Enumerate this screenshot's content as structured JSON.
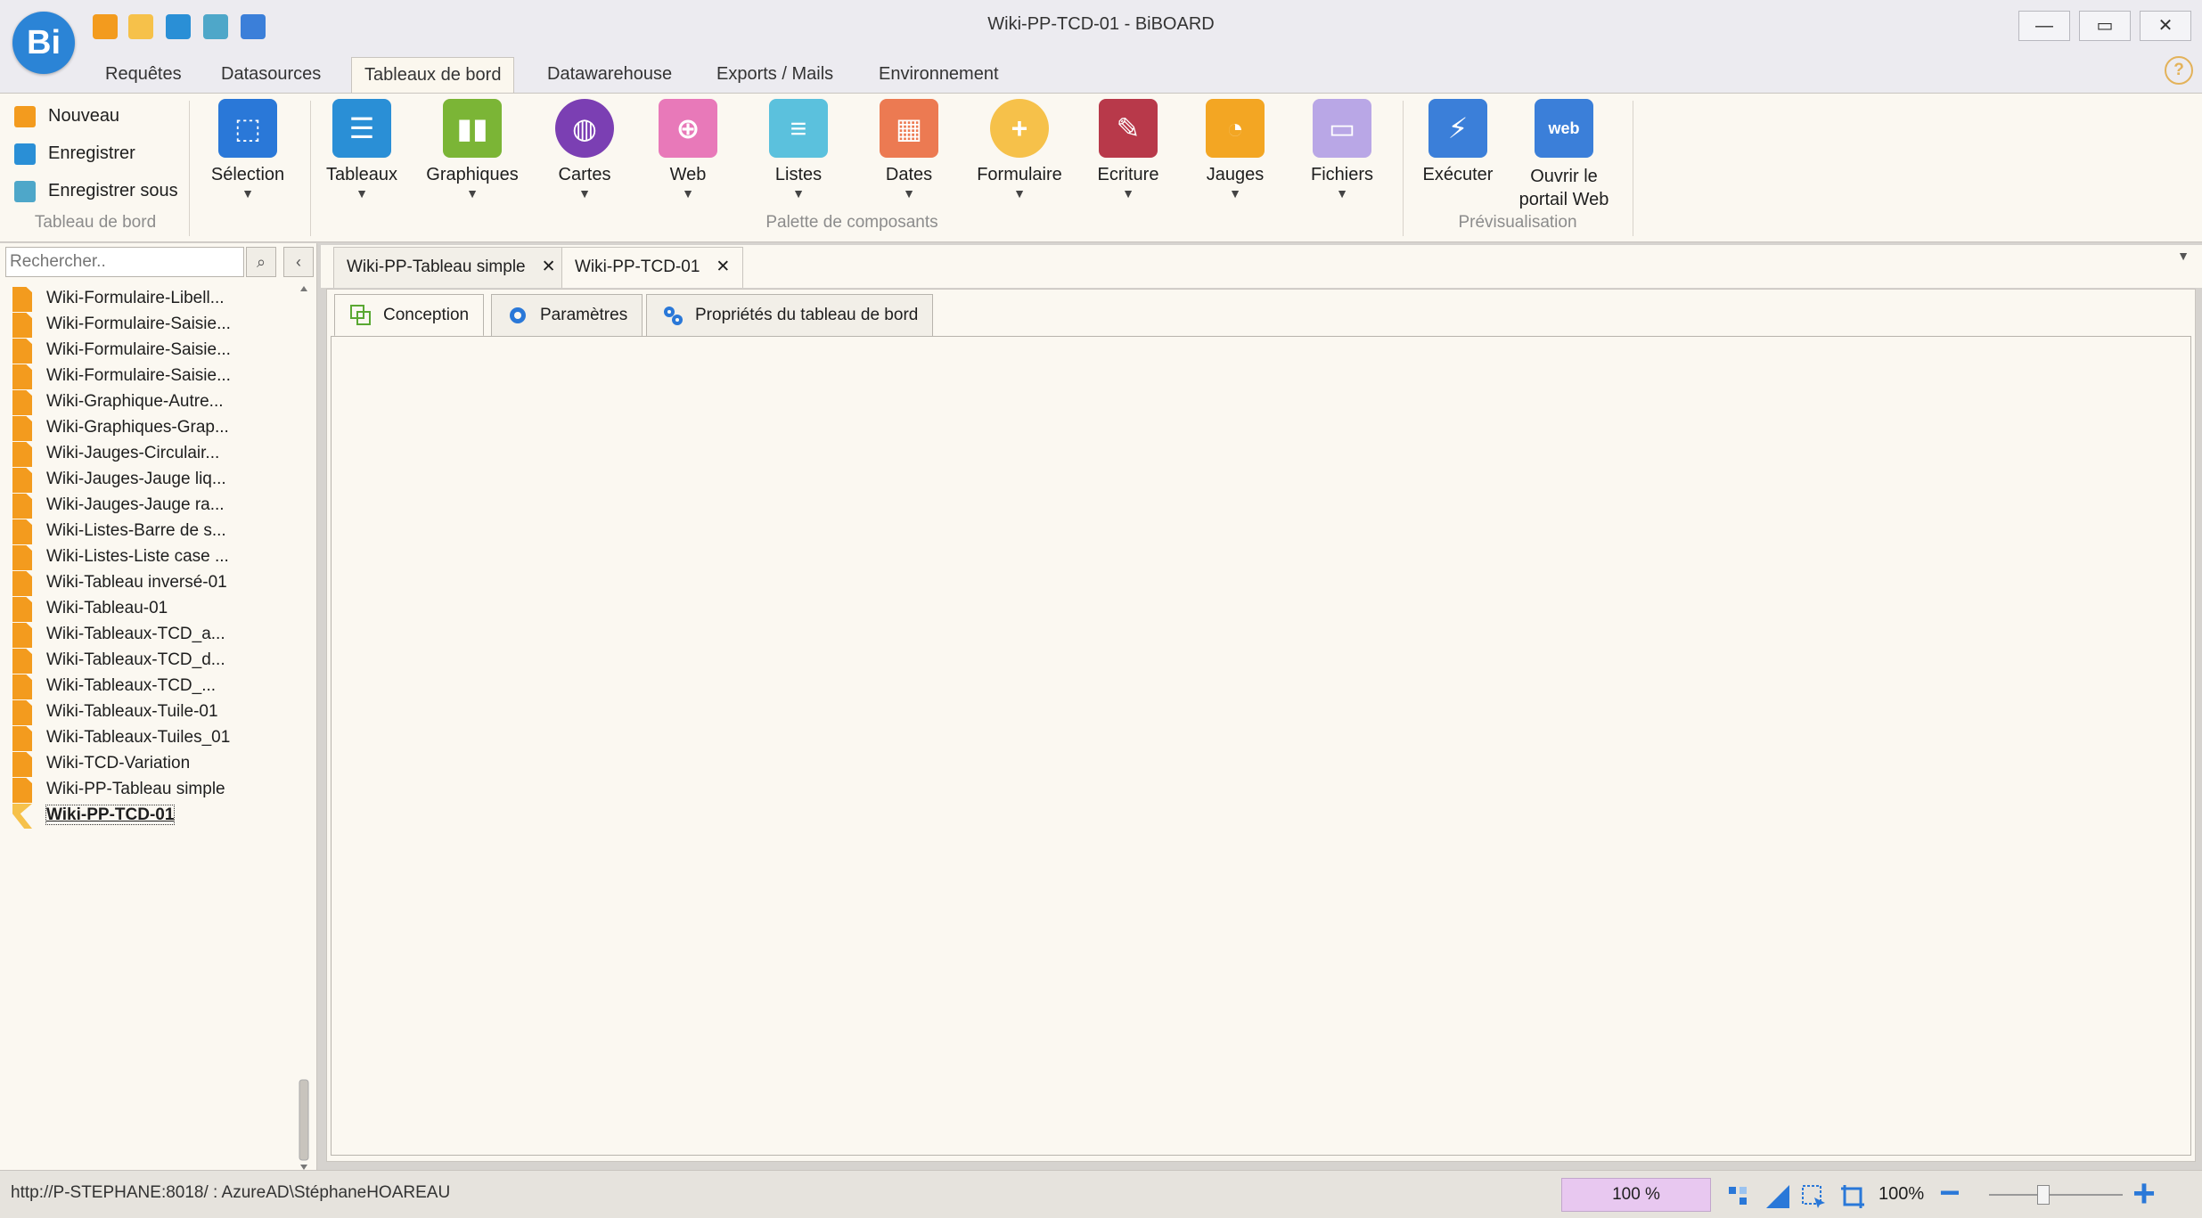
{
  "window": {
    "title": "Wiki-PP-TCD-01 - BiBOARD",
    "logo_text": "Bi",
    "controls": {
      "minimize": "—",
      "maximize": "▭",
      "close": "✕"
    }
  },
  "quick_access": [
    "new-file-icon",
    "new-folder-icon",
    "save-icon",
    "save-as-icon",
    "window-icon"
  ],
  "ribbon_tabs": [
    "Requêtes",
    "Datasources",
    "Tableaux de bord",
    "Datawarehouse",
    "Exports / Mails",
    "Environnement"
  ],
  "ribbon_active_tab": "Tableaux de bord",
  "help_label": "?",
  "ribbon": {
    "file_group": {
      "new": "Nouveau",
      "save": "Enregistrer",
      "save_as": "Enregistrer sous",
      "label": "Tableau de bord"
    },
    "selection": {
      "label": "Sélection"
    },
    "palette": {
      "label": "Palette de composants",
      "items": [
        {
          "label": "Tableaux",
          "color": "#2a8fd6"
        },
        {
          "label": "Graphiques",
          "color": "#7bb536"
        },
        {
          "label": "Cartes",
          "color": "#7b3fb3"
        },
        {
          "label": "Web",
          "color": "#e879b9"
        },
        {
          "label": "Listes",
          "color": "#5bc1dd"
        },
        {
          "label": "Dates",
          "color": "#ec7a52"
        },
        {
          "label": "Formulaire",
          "color": "#f6c14a"
        },
        {
          "label": "Ecriture",
          "color": "#b8394a"
        },
        {
          "label": "Jauges",
          "color": "#f3a623"
        },
        {
          "label": "Fichiers",
          "color": "#b9a7e6"
        }
      ]
    },
    "preview": {
      "label": "Prévisualisation",
      "execute": "Exécuter",
      "open_portal_line1": "Ouvrir le",
      "open_portal_line2": "portail Web"
    }
  },
  "left_panel": {
    "search_placeholder": "Rechercher..",
    "search_icon": "binoculars-icon",
    "collapse_icon": "chevron-left-icon",
    "items": [
      "Wiki-Formulaire-Libell...",
      "Wiki-Formulaire-Saisie...",
      "Wiki-Formulaire-Saisie...",
      "Wiki-Formulaire-Saisie...",
      "Wiki-Graphique-Autre...",
      "Wiki-Graphiques-Grap...",
      "Wiki-Jauges-Circulair...",
      "Wiki-Jauges-Jauge liq...",
      "Wiki-Jauges-Jauge ra...",
      "Wiki-Listes-Barre de s...",
      "Wiki-Listes-Liste case ...",
      "Wiki-Tableau inversé-01",
      "Wiki-Tableau-01",
      "Wiki-Tableaux-TCD_a...",
      "Wiki-Tableaux-TCD_d...",
      "Wiki-Tableaux-TCD_...",
      "Wiki-Tableaux-Tuile-01",
      "Wiki-Tableaux-Tuiles_01",
      "Wiki-TCD-Variation",
      "Wiki-PP-Tableau simple",
      "Wiki-PP-TCD-01"
    ],
    "selected_index": 20
  },
  "doc_tabs": [
    {
      "label": "Wiki-PP-Tableau simple",
      "close": "✕"
    },
    {
      "label": "Wiki-PP-TCD-01",
      "close": "✕"
    }
  ],
  "doc_tabs_overflow": "▼",
  "content_tabs": [
    {
      "label": "Conception",
      "icon": "design-icon"
    },
    {
      "label": "Paramètres",
      "icon": "gear-icon"
    },
    {
      "label": "Propriétés du tableau de bord",
      "icon": "gears-icon"
    }
  ],
  "status": {
    "connection": "http://P-STEPHANE:8018/ : AzureAD\\StéphaneHOAREAU",
    "zoom_box": "100 %",
    "zoom_level": "100%",
    "zoom_minus": "−",
    "zoom_plus": "+"
  },
  "colors": {
    "accent_blue": "#2a78d8",
    "file_orange": "#f39b1e",
    "ribbon_bg": "#fbf8f1"
  }
}
